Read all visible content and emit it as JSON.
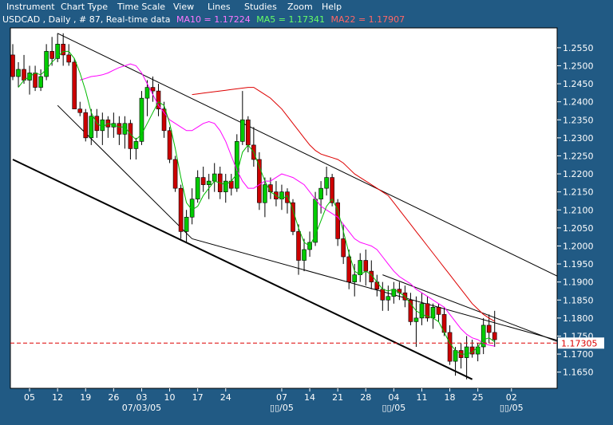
{
  "menu": {
    "items": [
      "Instrument",
      "Chart Type",
      "Time Scale",
      "View",
      "Lines",
      "Studies",
      "Zoom",
      "Help"
    ]
  },
  "info": {
    "symbol_text": "USDCAD , Daily , # 87, Real-time data",
    "ma10_text": "MA10 = 1.17224",
    "ma5_text": "MA5 = 1.17341",
    "ma22_text": "MA22 = 1.17907"
  },
  "colors": {
    "background": "#215a84",
    "plot": "#ffffff",
    "up_candle": "#00cc00",
    "down_candle": "#cc0000",
    "ma10": "#ff00ff",
    "ma5": "#00bb00",
    "ma22": "#dd0000",
    "trendline": "#000000",
    "current_price": "#dd0000"
  },
  "chart_data": {
    "type": "candlestick",
    "symbol": "USDCAD",
    "timeframe": "Daily",
    "ylim": [
      1.1605,
      1.2605
    ],
    "y_ticks": [
      "1.1650",
      "1.1700",
      "1.1750",
      "1.1800",
      "1.1850",
      "1.1900",
      "1.1950",
      "1.2000",
      "1.2050",
      "1.2100",
      "1.2150",
      "1.2200",
      "1.2250",
      "1.2300",
      "1.2350",
      "1.2400",
      "1.2450",
      "1.2500",
      "1.2550"
    ],
    "x_ticks": [
      "05",
      "12",
      "19",
      "26",
      "03",
      "10",
      "17",
      "24",
      "07",
      "14",
      "21",
      "28",
      "04",
      "11",
      "18",
      "25",
      "02"
    ],
    "x_tick_index": [
      3,
      8,
      13,
      18,
      23,
      28,
      33,
      38,
      48,
      53,
      58,
      63,
      68,
      73,
      78,
      83,
      89
    ],
    "x_month_labels": [
      "07/03/05",
      "▯▯/05",
      "▯▯/05",
      "▯▯/05"
    ],
    "x_month_index": [
      23,
      48,
      68,
      89
    ],
    "current_price": 1.17305,
    "current_price_label": "1.17305",
    "candles": [
      [
        1.253,
        1.256,
        1.246,
        1.247
      ],
      [
        1.247,
        1.251,
        1.244,
        1.249
      ],
      [
        1.249,
        1.253,
        1.245,
        1.246
      ],
      [
        1.246,
        1.25,
        1.242,
        1.248
      ],
      [
        1.248,
        1.25,
        1.243,
        1.244
      ],
      [
        1.244,
        1.249,
        1.243,
        1.247
      ],
      [
        1.247,
        1.256,
        1.246,
        1.254
      ],
      [
        1.254,
        1.258,
        1.25,
        1.252
      ],
      [
        1.252,
        1.259,
        1.251,
        1.256
      ],
      [
        1.256,
        1.259,
        1.25,
        1.253
      ],
      [
        1.253,
        1.256,
        1.25,
        1.251
      ],
      [
        1.251,
        1.252,
        1.238,
        1.238
      ],
      [
        1.238,
        1.24,
        1.236,
        1.237
      ],
      [
        1.237,
        1.238,
        1.229,
        1.23
      ],
      [
        1.23,
        1.238,
        1.228,
        1.236
      ],
      [
        1.236,
        1.238,
        1.23,
        1.232
      ],
      [
        1.232,
        1.237,
        1.228,
        1.235
      ],
      [
        1.235,
        1.236,
        1.23,
        1.233
      ],
      [
        1.233,
        1.237,
        1.23,
        1.234
      ],
      [
        1.234,
        1.236,
        1.228,
        1.231
      ],
      [
        1.231,
        1.236,
        1.227,
        1.234
      ],
      [
        1.234,
        1.235,
        1.224,
        1.227
      ],
      [
        1.227,
        1.23,
        1.224,
        1.229
      ],
      [
        1.229,
        1.243,
        1.228,
        1.241
      ],
      [
        1.241,
        1.246,
        1.236,
        1.244
      ],
      [
        1.244,
        1.247,
        1.24,
        1.243
      ],
      [
        1.243,
        1.245,
        1.236,
        1.238
      ],
      [
        1.238,
        1.24,
        1.23,
        1.232
      ],
      [
        1.232,
        1.233,
        1.223,
        1.224
      ],
      [
        1.224,
        1.225,
        1.215,
        1.216
      ],
      [
        1.216,
        1.217,
        1.202,
        1.204
      ],
      [
        1.204,
        1.21,
        1.201,
        1.208
      ],
      [
        1.208,
        1.216,
        1.206,
        1.213
      ],
      [
        1.213,
        1.221,
        1.212,
        1.219
      ],
      [
        1.219,
        1.222,
        1.215,
        1.217
      ],
      [
        1.217,
        1.22,
        1.213,
        1.218
      ],
      [
        1.218,
        1.223,
        1.215,
        1.22
      ],
      [
        1.22,
        1.222,
        1.213,
        1.215
      ],
      [
        1.215,
        1.22,
        1.212,
        1.218
      ],
      [
        1.218,
        1.22,
        1.214,
        1.216
      ],
      [
        1.216,
        1.231,
        1.215,
        1.229
      ],
      [
        1.229,
        1.243,
        1.228,
        1.235
      ],
      [
        1.235,
        1.236,
        1.226,
        1.228
      ],
      [
        1.228,
        1.233,
        1.222,
        1.224
      ],
      [
        1.224,
        1.226,
        1.21,
        1.212
      ],
      [
        1.212,
        1.219,
        1.208,
        1.217
      ],
      [
        1.217,
        1.219,
        1.213,
        1.215
      ],
      [
        1.215,
        1.218,
        1.211,
        1.213
      ],
      [
        1.213,
        1.217,
        1.21,
        1.215
      ],
      [
        1.215,
        1.216,
        1.209,
        1.212
      ],
      [
        1.212,
        1.213,
        1.203,
        1.204
      ],
      [
        1.204,
        1.206,
        1.192,
        1.196
      ],
      [
        1.196,
        1.202,
        1.193,
        1.199
      ],
      [
        1.199,
        1.204,
        1.197,
        1.201
      ],
      [
        1.201,
        1.215,
        1.2,
        1.213
      ],
      [
        1.213,
        1.218,
        1.209,
        1.216
      ],
      [
        1.216,
        1.222,
        1.214,
        1.219
      ],
      [
        1.219,
        1.22,
        1.211,
        1.212
      ],
      [
        1.212,
        1.213,
        1.2,
        1.202
      ],
      [
        1.202,
        1.206,
        1.195,
        1.197
      ],
      [
        1.197,
        1.199,
        1.188,
        1.19
      ],
      [
        1.19,
        1.195,
        1.186,
        1.192
      ],
      [
        1.192,
        1.198,
        1.19,
        1.196
      ],
      [
        1.196,
        1.199,
        1.189,
        1.193
      ],
      [
        1.193,
        1.196,
        1.188,
        1.19
      ],
      [
        1.19,
        1.192,
        1.186,
        1.188
      ],
      [
        1.188,
        1.19,
        1.182,
        1.185
      ],
      [
        1.185,
        1.189,
        1.182,
        1.186
      ],
      [
        1.186,
        1.19,
        1.184,
        1.188
      ],
      [
        1.188,
        1.19,
        1.185,
        1.187
      ],
      [
        1.187,
        1.189,
        1.183,
        1.185
      ],
      [
        1.185,
        1.187,
        1.178,
        1.179
      ],
      [
        1.179,
        1.186,
        1.172,
        1.18
      ],
      [
        1.18,
        1.187,
        1.178,
        1.184
      ],
      [
        1.184,
        1.186,
        1.179,
        1.18
      ],
      [
        1.18,
        1.184,
        1.177,
        1.183
      ],
      [
        1.183,
        1.184,
        1.179,
        1.181
      ],
      [
        1.181,
        1.183,
        1.175,
        1.176
      ],
      [
        1.176,
        1.178,
        1.167,
        1.168
      ],
      [
        1.168,
        1.172,
        1.164,
        1.171
      ],
      [
        1.171,
        1.173,
        1.166,
        1.169
      ],
      [
        1.169,
        1.175,
        1.163,
        1.172
      ],
      [
        1.172,
        1.174,
        1.169,
        1.17
      ],
      [
        1.17,
        1.173,
        1.168,
        1.172
      ],
      [
        1.172,
        1.18,
        1.17,
        1.178
      ],
      [
        1.178,
        1.181,
        1.173,
        1.176
      ],
      [
        1.176,
        1.182,
        1.172,
        1.174
      ]
    ],
    "ma5": [
      1.244,
      1.246,
      1.247,
      1.248,
      1.2475,
      1.249,
      1.251,
      1.2525,
      1.254,
      1.254,
      1.252,
      1.248,
      1.243,
      1.237,
      1.234,
      1.233,
      1.234,
      1.2335,
      1.233,
      1.233,
      1.231,
      1.2295,
      1.231,
      1.234,
      1.237,
      1.24,
      1.239,
      1.234,
      1.227,
      1.219,
      1.212,
      1.21,
      1.211,
      1.214,
      1.216,
      1.218,
      1.2175,
      1.217,
      1.218,
      1.22,
      1.226,
      1.228,
      1.226,
      1.222,
      1.218,
      1.215,
      1.214,
      1.213,
      1.214,
      1.21,
      1.205,
      1.201,
      1.2,
      1.203,
      1.207,
      1.211,
      1.213,
      1.21,
      1.204,
      1.198,
      1.193,
      1.192,
      1.193,
      1.192,
      1.19,
      1.188,
      1.1875,
      1.188,
      1.187,
      1.186,
      1.184,
      1.182,
      1.181,
      1.1805,
      1.18,
      1.179,
      1.176,
      1.173,
      1.171,
      1.17,
      1.17,
      1.1705,
      1.172,
      1.174,
      1.1745,
      1.1734
    ],
    "ma10": [
      1.246,
      1.2465,
      1.247,
      1.2472,
      1.2475,
      1.248,
      1.2488,
      1.2495,
      1.25,
      1.2505,
      1.25,
      1.248,
      1.245,
      1.242,
      1.239,
      1.237,
      1.235,
      1.234,
      1.233,
      1.232,
      1.232,
      1.233,
      1.234,
      1.2345,
      1.234,
      1.232,
      1.229,
      1.225,
      1.221,
      1.218,
      1.216,
      1.216,
      1.217,
      1.218,
      1.218,
      1.219,
      1.22,
      1.2195,
      1.219,
      1.218,
      1.217,
      1.215,
      1.213,
      1.211,
      1.21,
      1.209,
      1.208,
      1.206,
      1.204,
      1.202,
      1.201,
      1.2005,
      1.2,
      1.199,
      1.197,
      1.195,
      1.193,
      1.1915,
      1.1905,
      1.1895,
      1.188,
      1.187,
      1.186,
      1.185,
      1.184,
      1.183,
      1.181,
      1.179,
      1.177,
      1.1755,
      1.1745,
      1.174,
      1.173,
      1.1725,
      1.1722
    ],
    "ma22": [
      1.242,
      1.2422,
      1.2424,
      1.2426,
      1.2428,
      1.243,
      1.2432,
      1.2434,
      1.2436,
      1.2438,
      1.244,
      1.244,
      1.243,
      1.242,
      1.241,
      1.2395,
      1.238,
      1.236,
      1.234,
      1.232,
      1.23,
      1.228,
      1.2265,
      1.2255,
      1.225,
      1.2245,
      1.224,
      1.223,
      1.2215,
      1.22,
      1.219,
      1.218,
      1.217,
      1.216,
      1.215,
      1.214,
      1.212,
      1.21,
      1.208,
      1.206,
      1.204,
      1.202,
      1.2,
      1.198,
      1.196,
      1.194,
      1.192,
      1.19,
      1.188,
      1.186,
      1.184,
      1.1825,
      1.181,
      1.18,
      1.1791
    ],
    "trendlines": [
      {
        "start": [
          8,
          1.259
        ],
        "end": [
          98,
          1.191
        ],
        "weight": "thin"
      },
      {
        "start": [
          0,
          1.224
        ],
        "end": [
          82,
          1.163
        ],
        "weight": "thick"
      },
      {
        "start": [
          8,
          1.239
        ],
        "end": [
          32,
          1.202
        ],
        "weight": "thin"
      },
      {
        "start": [
          32,
          1.202
        ],
        "end": [
          98,
          1.1735
        ],
        "weight": "thin"
      },
      {
        "start": [
          66,
          1.192
        ],
        "end": [
          98,
          1.173
        ],
        "weight": "thin"
      }
    ]
  }
}
